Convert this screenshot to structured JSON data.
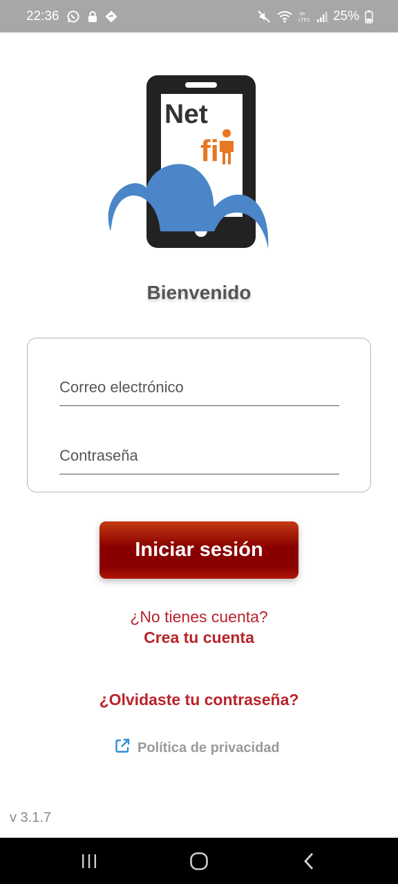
{
  "status_bar": {
    "time": "22:36",
    "battery": "25%",
    "icons_left": [
      "whatsapp-icon",
      "lock-icon",
      "navigation-icon"
    ],
    "icons_right": [
      "mute-icon",
      "wifi-icon",
      "volte-icon",
      "signal-icon",
      "battery-icon"
    ]
  },
  "logo": {
    "line1": "Net",
    "line2": "fi",
    "colors": {
      "phone": "#222222",
      "cloud": "#4a86c8",
      "accent": "#e87722"
    }
  },
  "welcome": "Bienvenido",
  "form": {
    "email_placeholder": "Correo electrónico",
    "password_placeholder": "Contraseña"
  },
  "login_button": "Iniciar sesión",
  "no_account": "¿No tienes cuenta?",
  "create_account": "Crea tu cuenta",
  "forgot_password": "¿Olvidaste tu contraseña?",
  "privacy": {
    "label": "Política de privacidad",
    "icon": "external-link-icon"
  },
  "version": "v 3.1.7",
  "nav_bar": {
    "buttons": [
      "recent-apps-icon",
      "home-icon",
      "back-icon"
    ]
  },
  "colors": {
    "accent_red": "#b8232a",
    "button_red": "#8a0000",
    "link_blue": "#2a8fd6"
  }
}
